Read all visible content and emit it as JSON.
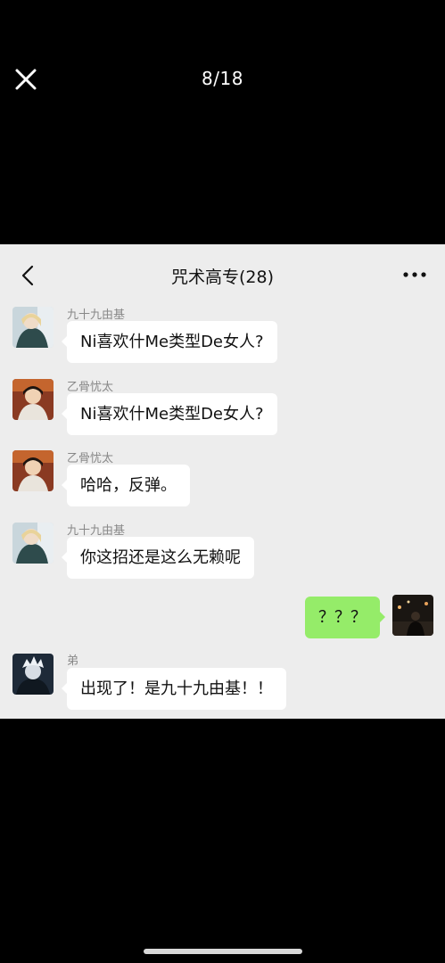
{
  "viewer": {
    "counter": "8/18",
    "close_icon": "close-icon"
  },
  "chat": {
    "title": "咒术高专(28)",
    "back_icon": "chevron-left-icon",
    "more_icon": "more-dots-icon",
    "messages": [
      {
        "sender": "九十九由基",
        "text": "Ni喜欢什Me类型De女人?",
        "side": "left"
      },
      {
        "sender": "乙骨忧太",
        "text": "Ni喜欢什Me类型De女人?",
        "side": "left"
      },
      {
        "sender": "乙骨忧太",
        "text": "哈哈，反弹。",
        "side": "left"
      },
      {
        "sender": "九十九由基",
        "text": "你这招还是这么无赖呢",
        "side": "left"
      },
      {
        "sender": "",
        "text": "？？？",
        "side": "right"
      },
      {
        "sender": "弟",
        "text": "出现了！是九十九由基！！",
        "side": "left"
      }
    ]
  },
  "colors": {
    "chat_background": "#ededed",
    "my_bubble": "#95ec69",
    "other_bubble": "#ffffff",
    "viewer_background": "#000000"
  }
}
